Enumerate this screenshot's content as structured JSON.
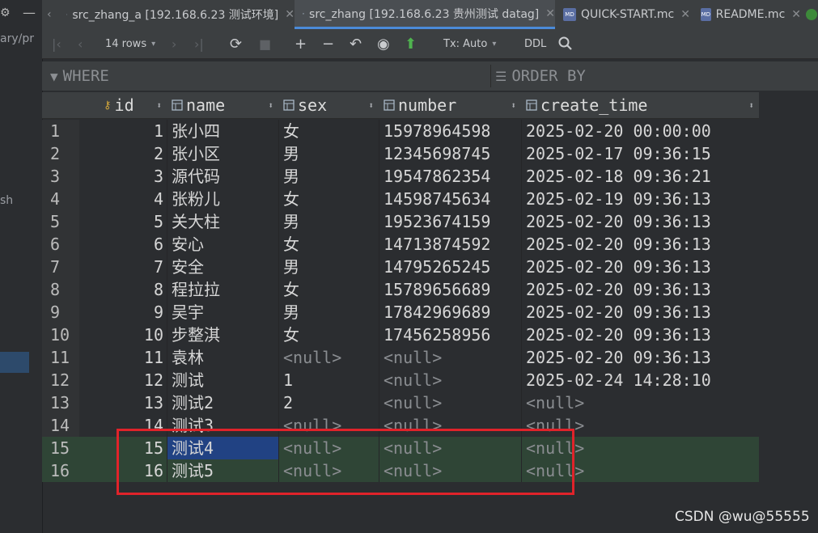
{
  "left_panel": {
    "fragments": [
      "ary/pr",
      "sh"
    ]
  },
  "tabs": [
    {
      "label": "src_zhang_a [192.168.6.23 测试环境]",
      "icon": "table-icon",
      "active": false
    },
    {
      "label": "src_zhang [192.168.6.23 贵州测试 datag]",
      "icon": "table-icon",
      "active": true
    },
    {
      "label": "QUICK-START.mc",
      "icon": "markdown-icon",
      "active": false
    },
    {
      "label": "README.mc",
      "icon": "markdown-icon",
      "active": false
    }
  ],
  "toolbar": {
    "rows_label": "14 rows",
    "tx_label": "Tx: Auto",
    "ddl_label": "DDL"
  },
  "filter": {
    "where_label": "WHERE",
    "order_label": "ORDER BY"
  },
  "columns": [
    "id",
    "name",
    "sex",
    "number",
    "create_time"
  ],
  "rows": [
    {
      "n": "1",
      "id": "1",
      "name": "张小四",
      "sex": "女",
      "number": "15978964598",
      "create_time": "2025-02-20 00:00:00"
    },
    {
      "n": "2",
      "id": "2",
      "name": "张小区",
      "sex": "男",
      "number": "12345698745",
      "create_time": "2025-02-17 09:36:15"
    },
    {
      "n": "3",
      "id": "3",
      "name": "源代码",
      "sex": "男",
      "number": "19547862354",
      "create_time": "2025-02-18 09:36:21"
    },
    {
      "n": "4",
      "id": "4",
      "name": "张粉儿",
      "sex": "女",
      "number": "14598745634",
      "create_time": "2025-02-19 09:36:13"
    },
    {
      "n": "5",
      "id": "5",
      "name": "关大柱",
      "sex": "男",
      "number": "19523674159",
      "create_time": "2025-02-20 09:36:13"
    },
    {
      "n": "6",
      "id": "6",
      "name": "安心",
      "sex": "女",
      "number": "14713874592",
      "create_time": "2025-02-20 09:36:13"
    },
    {
      "n": "7",
      "id": "7",
      "name": "安全",
      "sex": "男",
      "number": "14795265245",
      "create_time": "2025-02-20 09:36:13"
    },
    {
      "n": "8",
      "id": "8",
      "name": "程拉拉",
      "sex": "女",
      "number": "15789656689",
      "create_time": "2025-02-20 09:36:13"
    },
    {
      "n": "9",
      "id": "9",
      "name": "吴宇",
      "sex": "男",
      "number": "17842969689",
      "create_time": "2025-02-20 09:36:13"
    },
    {
      "n": "10",
      "id": "10",
      "name": "步整淇",
      "sex": "女",
      "number": "17456258956",
      "create_time": "2025-02-20 09:36:13"
    },
    {
      "n": "11",
      "id": "11",
      "name": "袁林",
      "sex": "<null>",
      "number": "<null>",
      "create_time": "2025-02-20 09:36:13"
    },
    {
      "n": "12",
      "id": "12",
      "name": "测试",
      "sex": "1",
      "number": "<null>",
      "create_time": "2025-02-24 14:28:10"
    },
    {
      "n": "13",
      "id": "13",
      "name": "测试2",
      "sex": "2",
      "number": "<null>",
      "create_time": "<null>"
    },
    {
      "n": "14",
      "id": "14",
      "name": "测试3",
      "sex": "<null>",
      "number": "<null>",
      "create_time": "<null>"
    },
    {
      "n": "15",
      "id": "15",
      "name": "测试4",
      "sex": "<null>",
      "number": "<null>",
      "create_time": "<null>"
    },
    {
      "n": "16",
      "id": "16",
      "name": "测试5",
      "sex": "<null>",
      "number": "<null>",
      "create_time": "<null>"
    }
  ],
  "highlight_rows": [
    "15",
    "16"
  ],
  "selected_cell": {
    "row": "15",
    "column": "name"
  },
  "colors": {
    "new_row_bg": "#2f4536",
    "selected_cell_bg": "#214283",
    "annotation_box": "#e0232a",
    "active_tab_underline": "#4b8bd9"
  },
  "watermark": "CSDN @wu@55555"
}
